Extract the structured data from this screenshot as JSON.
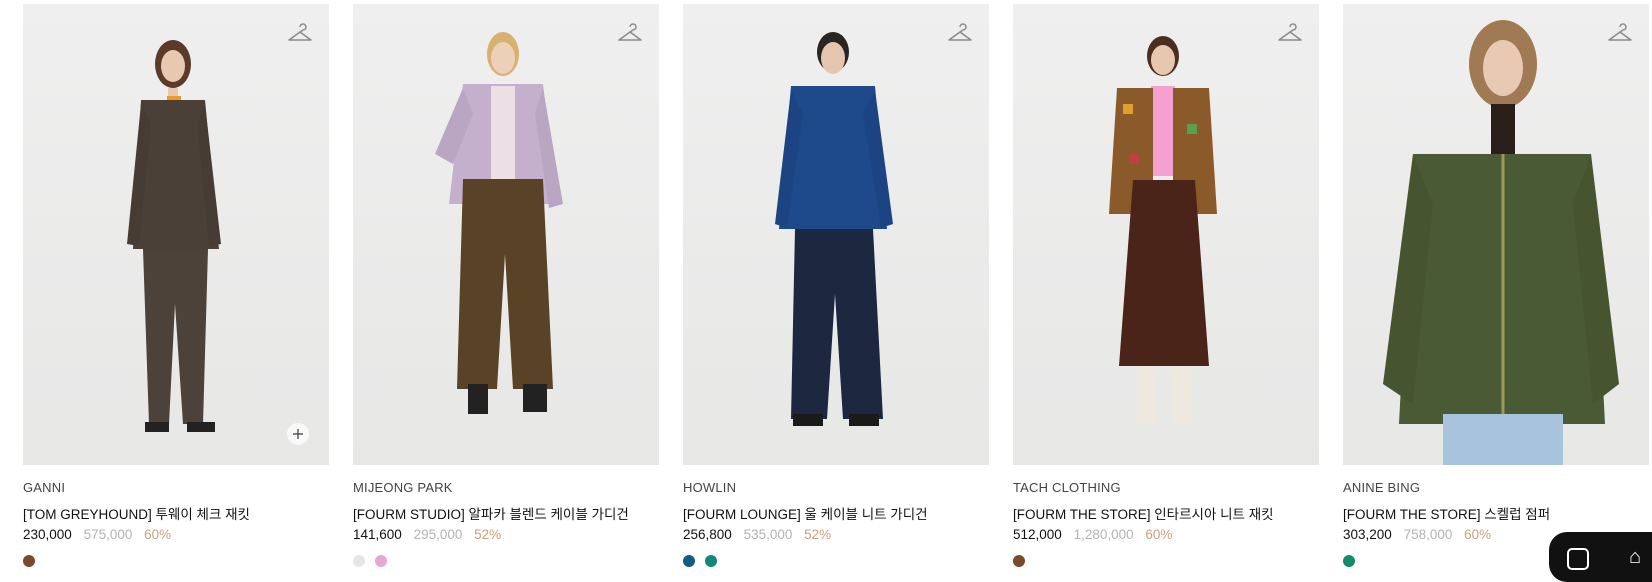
{
  "products": [
    {
      "brand": "GANNI",
      "title": "[TOM GREYHOUND] 투웨이 체크 재킷",
      "price": "230,000",
      "original_price": "575,000",
      "discount": "60%",
      "swatches": [
        "#7a4a2a"
      ],
      "show_plus": true
    },
    {
      "brand": "MIJEONG PARK",
      "title": "[FOURM STUDIO] 알파카 블렌드 케이블 가디건",
      "price": "141,600",
      "original_price": "295,000",
      "discount": "52%",
      "swatches": [
        "#e6e6e6",
        "#e8a6d6"
      ],
      "show_plus": false
    },
    {
      "brand": "HOWLIN",
      "title": "[FOURM LOUNGE] 울 케이블 니트 가디건",
      "price": "256,800",
      "original_price": "535,000",
      "discount": "52%",
      "swatches": [
        "#0f5c88",
        "#0f8a7a"
      ],
      "show_plus": false
    },
    {
      "brand": "TACH CLOTHING",
      "title": "[FOURM THE STORE] 인타르시아 니트 재킷",
      "price": "512,000",
      "original_price": "1,280,000",
      "discount": "60%",
      "swatches": [
        "#7a4a2a"
      ],
      "show_plus": false
    },
    {
      "brand": "ANINE BING",
      "title": "[FOURM THE STORE] 스켈럽 점퍼",
      "price": "303,200",
      "original_price": "758,000",
      "discount": "60%",
      "swatches": [
        "#138a6a"
      ],
      "show_plus": false
    }
  ],
  "colors": {
    "discount": "#c6a27a",
    "original_price": "#b3b3b3"
  }
}
